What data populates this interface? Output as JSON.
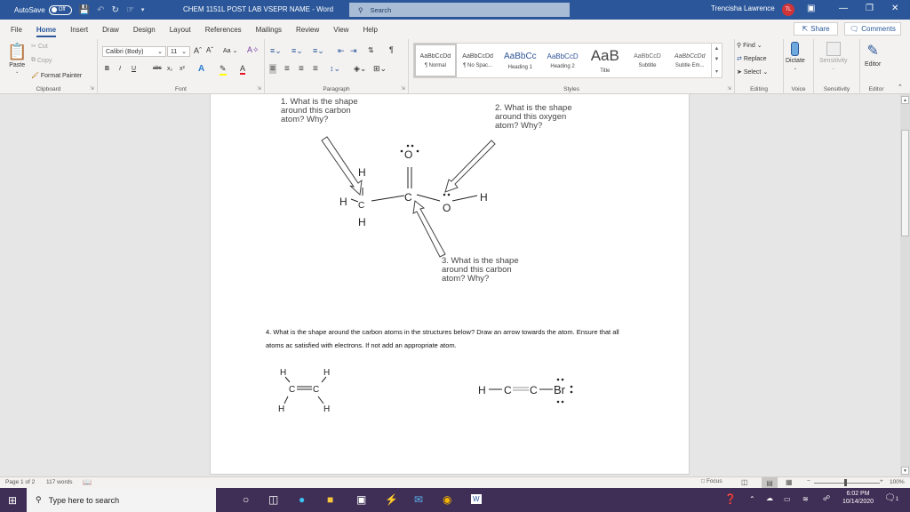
{
  "titlebar": {
    "autosave_label": "AutoSave",
    "autosave_state": "Off",
    "document_title": "CHEM 1151L  POST LAB VSEPR  NAME  -  Word",
    "search_placeholder": "Search",
    "user_name": "Trencisha Lawrence",
    "user_initials": "TL",
    "avatar_color": "#d13438",
    "accent_color": "#2b579a"
  },
  "tabs": [
    "File",
    "Home",
    "Insert",
    "Draw",
    "Design",
    "Layout",
    "References",
    "Mailings",
    "Review",
    "View",
    "Help"
  ],
  "active_tab": "Home",
  "share_label": "Share",
  "comments_label": "Comments",
  "ribbon": {
    "clipboard": {
      "label": "Clipboard",
      "paste": "Paste",
      "cut": "Cut",
      "copy": "Copy",
      "format_painter": "Format Painter"
    },
    "font": {
      "label": "Font",
      "font_name": "Calibri (Body)",
      "font_size": "11",
      "change_case": "Aa",
      "bold": "B",
      "italic": "I",
      "underline": "U",
      "strikethrough": "abc",
      "subscript": "x₂",
      "superscript": "x²",
      "highlight_color": "#ffff00",
      "font_color": "#e81123"
    },
    "paragraph": {
      "label": "Paragraph"
    },
    "styles": {
      "label": "Styles",
      "items": [
        {
          "preview": "AaBbCcDd",
          "name": "¶ Normal"
        },
        {
          "preview": "AaBbCcDd",
          "name": "¶ No Spac..."
        },
        {
          "preview": "AaBbCc",
          "name": "Heading 1"
        },
        {
          "preview": "AaBbCcD",
          "name": "Heading 2"
        },
        {
          "preview": "AaB",
          "name": "Title"
        },
        {
          "preview": "AaBbCcD",
          "name": "Subtitle"
        },
        {
          "preview": "AaBbCcDd",
          "name": "Subtle Em..."
        }
      ]
    },
    "editing": {
      "label": "Editing",
      "find": "Find",
      "replace": "Replace",
      "select": "Select"
    },
    "voice": {
      "label": "Voice",
      "dictate": "Dictate"
    },
    "sensitivity": {
      "label": "Sensitivity",
      "button": "Sensitivity"
    },
    "editor": {
      "label": "Editor",
      "button": "Editor"
    }
  },
  "document": {
    "q1": [
      "1.  What is the shape",
      "around this carbon",
      "atom?  Why?"
    ],
    "q2": [
      "2.  What is the shape",
      "around this oxygen",
      "atom?  Why?"
    ],
    "q3": [
      "3.  What is the shape",
      "around this carbon",
      "atom?  Why?"
    ],
    "q4": "4. What is the shape around the carbon atoms in the structures below? Draw an arrow towards the atom. Ensure that all atoms ac satisfied with electrons. If not add an appropriate atom.",
    "molecule1_atoms": {
      "H": "H",
      "C": "C",
      "O": "O"
    },
    "molecule2": {
      "H": "H",
      "C": "C"
    },
    "molecule3": {
      "H": "H",
      "C": "C",
      "Br": "Br"
    }
  },
  "statusbar": {
    "page": "Page 1 of 2",
    "words": "117 words",
    "focus": "Focus",
    "zoom": "100%",
    "zoom_minus": "−",
    "zoom_plus": "+"
  },
  "taskbar": {
    "search_placeholder": "Type here to search",
    "time": "6:02 PM",
    "date": "10/14/2020",
    "notification_count": "1",
    "bg_color": "#3f2e55"
  }
}
